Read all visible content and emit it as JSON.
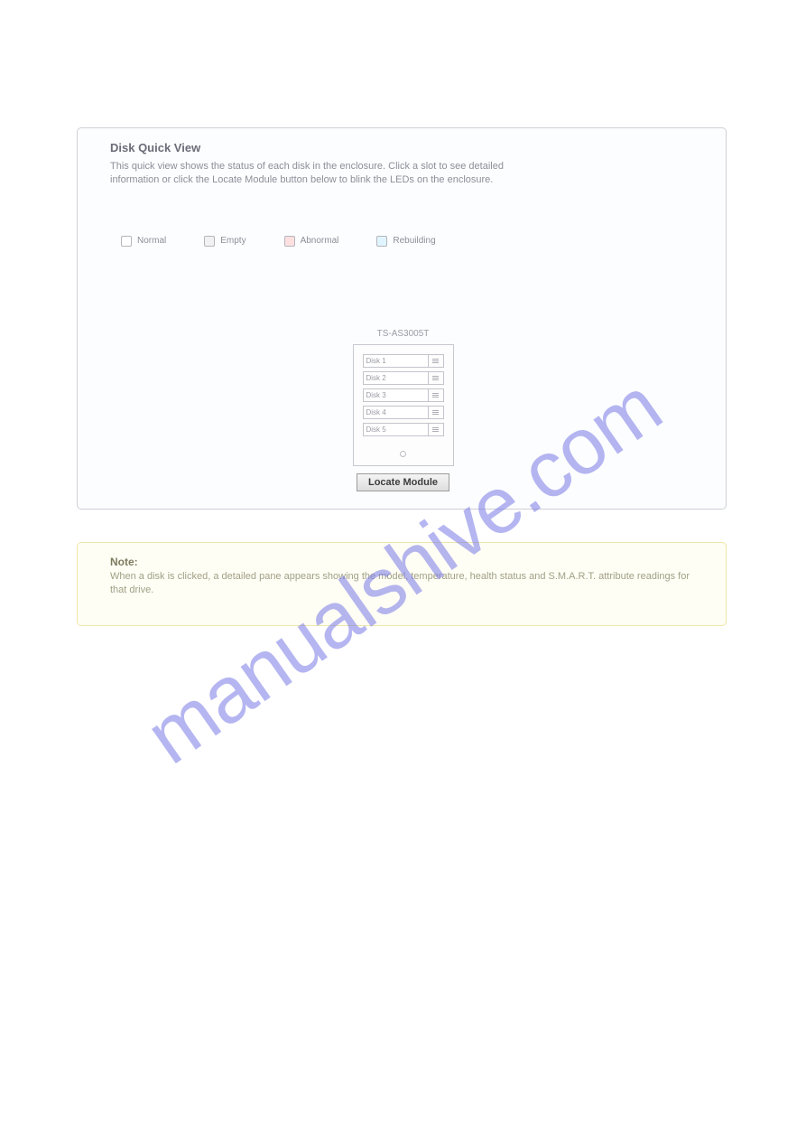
{
  "watermark": "manualshive.com",
  "panel": {
    "title": "Disk Quick View",
    "subtitle_line1": "This quick view shows the status of each disk in the enclosure. Click a slot to see detailed",
    "subtitle_line2": "information or click the Locate Module button below to blink the LEDs on the enclosure."
  },
  "legend": {
    "normal": "Normal",
    "empty": "Empty",
    "abnormal": "Abnormal",
    "rebuilding": "Rebuilding"
  },
  "device": {
    "caption": "TS-AS3005T",
    "bays": [
      "Disk 1",
      "Disk 2",
      "Disk 3",
      "Disk 4",
      "Disk 5"
    ]
  },
  "locate_button": "Locate Module",
  "note": {
    "title": "Note:",
    "text": "When a disk is clicked, a detailed pane appears showing the model, temperature, health status and S.M.A.R.T. attribute readings for that drive."
  }
}
